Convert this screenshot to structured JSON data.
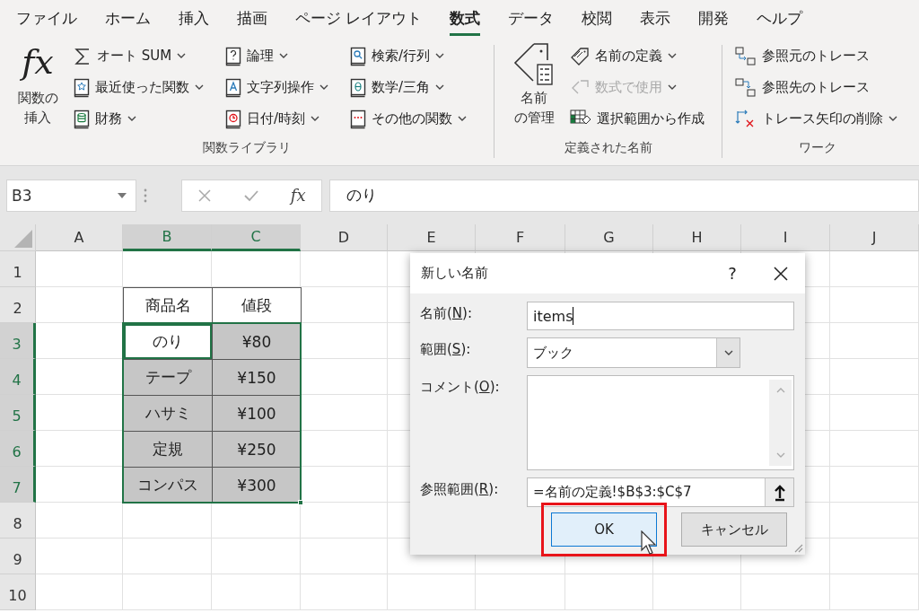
{
  "menu_tabs": [
    {
      "label": "ファイル",
      "selected": false
    },
    {
      "label": "ホーム",
      "selected": false
    },
    {
      "label": "挿入",
      "selected": false
    },
    {
      "label": "描画",
      "selected": false
    },
    {
      "label": "ページ レイアウト",
      "selected": false
    },
    {
      "label": "数式",
      "selected": true
    },
    {
      "label": "データ",
      "selected": false
    },
    {
      "label": "校閲",
      "selected": false
    },
    {
      "label": "表示",
      "selected": false
    },
    {
      "label": "開発",
      "selected": false
    },
    {
      "label": "ヘルプ",
      "selected": false
    }
  ],
  "ribbon": {
    "groups": [
      {
        "label": "関数ライブラリ",
        "big_button": {
          "symbol": "fx",
          "label_lines": [
            "関数の",
            "挿入"
          ]
        },
        "columns": [
          [
            {
              "label": "オート SUM",
              "dropdown": true,
              "disabled": false
            },
            {
              "label": "最近使った関数",
              "dropdown": true,
              "disabled": false
            },
            {
              "label": "財務",
              "dropdown": true,
              "disabled": false
            }
          ],
          [
            {
              "label": "論理",
              "dropdown": true,
              "disabled": false
            },
            {
              "label": "文字列操作",
              "dropdown": true,
              "disabled": false
            },
            {
              "label": "日付/時刻",
              "dropdown": true,
              "disabled": false
            }
          ],
          [
            {
              "label": "検索/行列",
              "dropdown": true,
              "disabled": false
            },
            {
              "label": "数学/三角",
              "dropdown": true,
              "disabled": false
            },
            {
              "label": "その他の関数",
              "dropdown": true,
              "disabled": false
            }
          ]
        ]
      },
      {
        "label": "定義された名前",
        "big_button": {
          "label_lines": [
            "名前",
            "の管理"
          ]
        },
        "columns": [
          [
            {
              "label": "名前の定義",
              "dropdown": true,
              "disabled": false
            },
            {
              "label": "数式で使用",
              "dropdown": true,
              "disabled": true
            },
            {
              "label": "選択範囲から作成",
              "dropdown": false,
              "disabled": false
            }
          ]
        ]
      },
      {
        "label": "ワーク",
        "columns": [
          [
            {
              "label": "参照元のトレース",
              "dropdown": false,
              "disabled": false
            },
            {
              "label": "参照先のトレース",
              "dropdown": false,
              "disabled": false
            },
            {
              "label": "トレース矢印の削除",
              "dropdown": true,
              "disabled": false
            }
          ]
        ]
      }
    ]
  },
  "formula_bar": {
    "name_box": "B3",
    "function_symbol": "fx",
    "value": "のり"
  },
  "sheet": {
    "columns": [
      {
        "label": "A",
        "selected": false
      },
      {
        "label": "B",
        "selected": true
      },
      {
        "label": "C",
        "selected": true
      },
      {
        "label": "D",
        "selected": false
      },
      {
        "label": "E",
        "selected": false
      },
      {
        "label": "F",
        "selected": false
      },
      {
        "label": "G",
        "selected": false
      },
      {
        "label": "H",
        "selected": false
      },
      {
        "label": "I",
        "selected": false
      },
      {
        "label": "J",
        "selected": false
      }
    ],
    "rows": [
      {
        "label": "1",
        "selected": false
      },
      {
        "label": "2",
        "selected": false,
        "cells": [
          {
            "text": "商品名",
            "selected": false,
            "active": false
          },
          {
            "text": "値段",
            "selected": false,
            "active": false
          }
        ]
      },
      {
        "label": "3",
        "selected": true,
        "cells": [
          {
            "text": "のり",
            "selected": true,
            "active": true
          },
          {
            "text": "¥80",
            "selected": true,
            "active": false
          }
        ]
      },
      {
        "label": "4",
        "selected": true,
        "cells": [
          {
            "text": "テープ",
            "selected": true,
            "active": false
          },
          {
            "text": "¥150",
            "selected": true,
            "active": false
          }
        ]
      },
      {
        "label": "5",
        "selected": true,
        "cells": [
          {
            "text": "ハサミ",
            "selected": true,
            "active": false
          },
          {
            "text": "¥100",
            "selected": true,
            "active": false
          }
        ]
      },
      {
        "label": "6",
        "selected": true,
        "cells": [
          {
            "text": "定規",
            "selected": true,
            "active": false
          },
          {
            "text": "¥250",
            "selected": true,
            "active": false
          }
        ]
      },
      {
        "label": "7",
        "selected": true,
        "cells": [
          {
            "text": "コンパス",
            "selected": true,
            "active": false
          },
          {
            "text": "¥300",
            "selected": true,
            "active": false
          }
        ]
      },
      {
        "label": "8",
        "selected": false
      },
      {
        "label": "9",
        "selected": false
      },
      {
        "label": "10",
        "selected": false
      }
    ]
  },
  "dialog": {
    "title": "新しい名前",
    "help": "?",
    "fields": [
      {
        "kind": "text",
        "label_before": "名前(",
        "mnemonic": "N",
        "label_after": "):",
        "value": "items",
        "focused": true
      },
      {
        "kind": "dropdown",
        "label_before": "範囲(",
        "mnemonic": "S",
        "label_after": "):",
        "value": "ブック"
      },
      {
        "kind": "textarea",
        "label_before": "コメント(",
        "mnemonic": "O",
        "label_after": "):"
      },
      {
        "kind": "range",
        "label_before": "参照範囲(",
        "mnemonic": "R",
        "label_after": "):",
        "value": "=名前の定義!$B$3:$C$7"
      }
    ],
    "buttons": [
      {
        "label": "OK",
        "default": true,
        "highlighted": true
      },
      {
        "label": "キャンセル",
        "default": false,
        "highlighted": false
      }
    ]
  }
}
